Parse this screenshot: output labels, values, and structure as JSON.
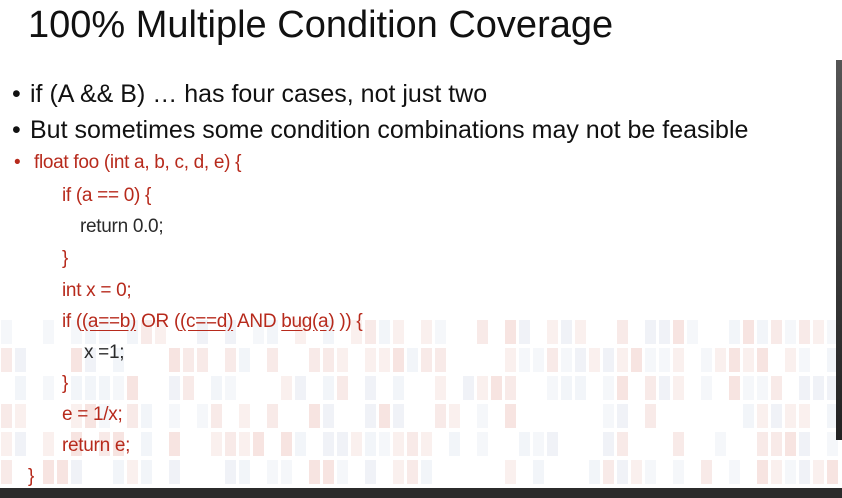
{
  "slide": {
    "title": "100% Multiple Condition Coverage",
    "bullets": [
      "if (A && B) … has four cases, not just two",
      "But sometimes some condition combinations may not be feasible"
    ],
    "bullet_glyph": "•",
    "code": {
      "line0": "float foo (int a, b, c, d, e) {",
      "line1": "if (a == 0) {",
      "line2": "return 0.0;",
      "line3": "}",
      "line4": "int x = 0;",
      "line5": {
        "p1": "if (",
        "u1": "(a==b)",
        "p2": " OR (",
        "u2": "(c==d)",
        "p3": " AND ",
        "u3": "bug(a)",
        "p4": " )) {"
      },
      "line6": "x =1;",
      "line7": "}",
      "line8": "e = 1/x;",
      "line9": "return e;",
      "line10": "}"
    }
  },
  "colors": {
    "code_red": "#b72a1c",
    "text": "#111111",
    "bottom_bar": "#2b2b2b"
  }
}
